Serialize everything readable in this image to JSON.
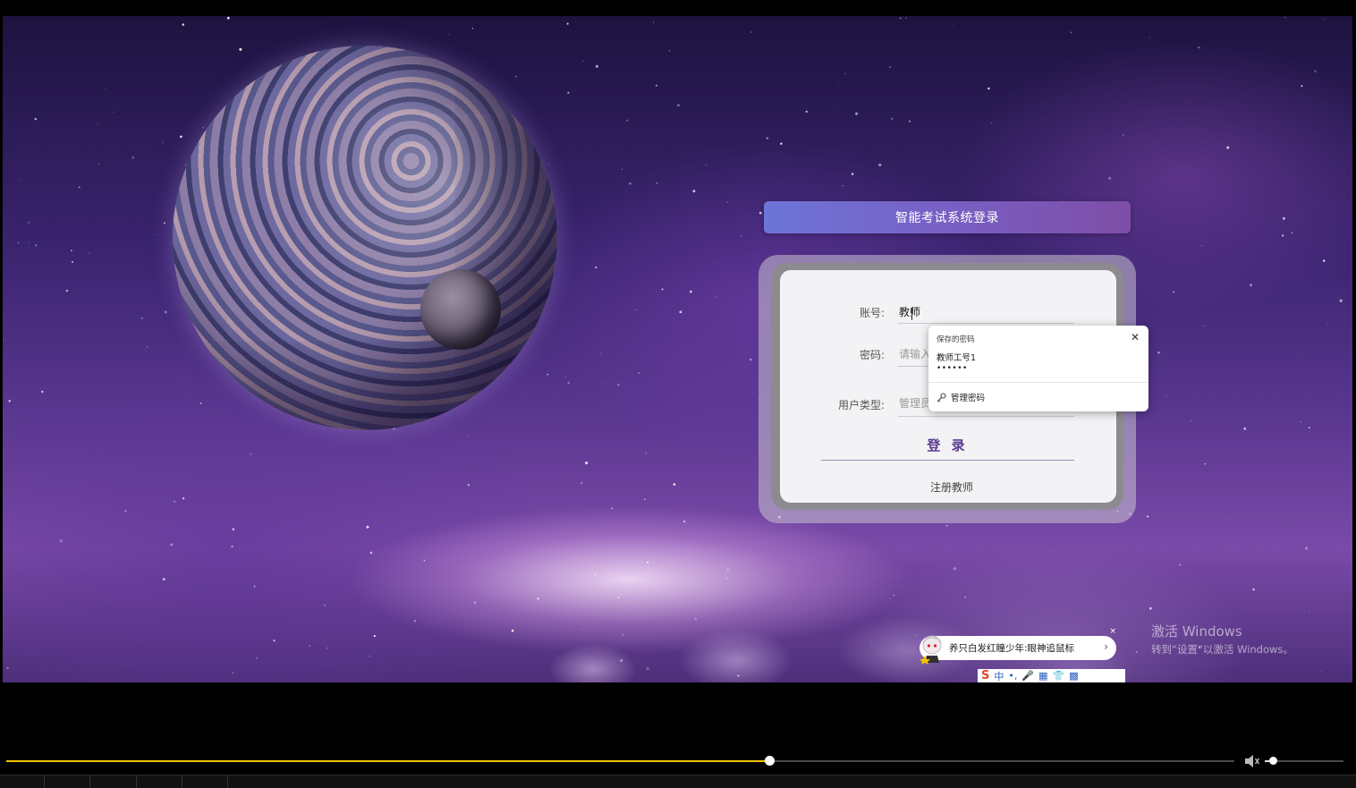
{
  "login": {
    "title": "智能考试系统登录",
    "account_label": "账号:",
    "account_value": "教师",
    "password_label": "密码:",
    "password_placeholder": "请输入",
    "usertype_label": "用户类型:",
    "usertype_value": "管理员",
    "login_button": "登 录",
    "register_link": "注册教师"
  },
  "password_popup": {
    "header": "保存的密码",
    "account": "教师工号1",
    "masked_password": "••••••",
    "manage": "管理密码",
    "close_icon": "close-icon",
    "manage_icon": "key-icon"
  },
  "toast": {
    "text": "养只白发红瞳少年:眼神追鼠标",
    "arrow": "›",
    "close": "×"
  },
  "ime_bar": {
    "logo": "S",
    "mode": "中"
  },
  "watermark": {
    "line1": "激活 Windows",
    "line2": "转到“设置”以激活 Windows。"
  },
  "player": {
    "progress": 0.621,
    "volume": 0.1,
    "accent_color": "#f0c400"
  },
  "colors": {
    "title_gradient_start": "#6d75d8",
    "title_gradient_end": "#7e4ea6",
    "login_button_text": "#5b3b90"
  }
}
